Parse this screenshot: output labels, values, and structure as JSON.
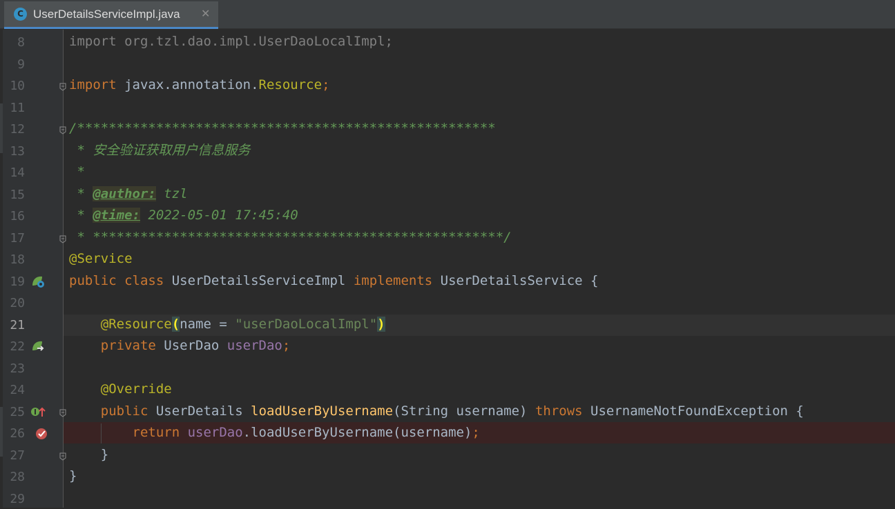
{
  "tab": {
    "title": "UserDetailsServiceImpl.java",
    "icon": "java-class-icon",
    "icon_letter": "C",
    "close": "✕"
  },
  "editor": {
    "lines": [
      {
        "n": "8",
        "segments": [
          {
            "t": "import org.tzl.dao.impl.UserDaoLocalImpl;",
            "c": "dim"
          }
        ]
      },
      {
        "n": "9",
        "segments": []
      },
      {
        "n": "10",
        "segments": [
          {
            "t": "import ",
            "c": "kw"
          },
          {
            "t": "javax.annotation.",
            "c": "cls"
          },
          {
            "t": "Resource",
            "c": "ann"
          },
          {
            "t": ";",
            "c": "kw"
          }
        ]
      },
      {
        "n": "11",
        "segments": []
      },
      {
        "n": "12",
        "segments": [
          {
            "t": "/*****************************************************",
            "c": "doc"
          }
        ]
      },
      {
        "n": "13",
        "segments": [
          {
            "t": " * 安全验证获取用户信息服务",
            "c": "doc"
          }
        ]
      },
      {
        "n": "14",
        "segments": [
          {
            "t": " *",
            "c": "doc"
          }
        ]
      },
      {
        "n": "15",
        "segments": [
          {
            "t": " * ",
            "c": "doc"
          },
          {
            "t": "@author:",
            "c": "doctag"
          },
          {
            "t": " tzl",
            "c": "doc"
          }
        ]
      },
      {
        "n": "16",
        "segments": [
          {
            "t": " * ",
            "c": "doc"
          },
          {
            "t": "@time:",
            "c": "doctag"
          },
          {
            "t": " 2022-05-01 17:45:40",
            "c": "doc"
          }
        ]
      },
      {
        "n": "17",
        "segments": [
          {
            "t": " * ****************************************************/",
            "c": "doc"
          }
        ]
      },
      {
        "n": "18",
        "segments": [
          {
            "t": "@Service",
            "c": "ann"
          }
        ]
      },
      {
        "n": "19",
        "segments": [
          {
            "t": "public class ",
            "c": "kw"
          },
          {
            "t": "UserDetailsServiceImpl ",
            "c": "cls"
          },
          {
            "t": "implements ",
            "c": "kw"
          },
          {
            "t": "UserDetailsService {",
            "c": "cls"
          }
        ]
      },
      {
        "n": "20",
        "segments": []
      },
      {
        "n": "21",
        "segments": [
          {
            "t": "    ",
            "c": "cls"
          },
          {
            "t": "@Resource",
            "c": "ann"
          },
          {
            "t": "(",
            "c": "paren-hl"
          },
          {
            "t": "name = ",
            "c": "cls"
          },
          {
            "t": "\"userDaoLocalImpl\"",
            "c": "str"
          },
          {
            "t": ")",
            "c": "paren-hl"
          }
        ]
      },
      {
        "n": "22",
        "segments": [
          {
            "t": "    ",
            "c": "cls"
          },
          {
            "t": "private ",
            "c": "kw"
          },
          {
            "t": "UserDao ",
            "c": "cls"
          },
          {
            "t": "userDao",
            "c": "field"
          },
          {
            "t": ";",
            "c": "kw"
          }
        ]
      },
      {
        "n": "23",
        "segments": []
      },
      {
        "n": "24",
        "segments": [
          {
            "t": "    ",
            "c": "cls"
          },
          {
            "t": "@Override",
            "c": "ann"
          }
        ]
      },
      {
        "n": "25",
        "segments": [
          {
            "t": "    ",
            "c": "cls"
          },
          {
            "t": "public ",
            "c": "kw"
          },
          {
            "t": "UserDetails ",
            "c": "cls"
          },
          {
            "t": "loadUserByUsername",
            "c": "fn"
          },
          {
            "t": "(String username) ",
            "c": "cls"
          },
          {
            "t": "throws ",
            "c": "kw"
          },
          {
            "t": "UsernameNotFoundException {",
            "c": "cls"
          }
        ]
      },
      {
        "n": "26",
        "segments": [
          {
            "t": "        ",
            "c": "cls"
          },
          {
            "t": "return ",
            "c": "kw"
          },
          {
            "t": "userDao",
            "c": "field"
          },
          {
            "t": ".loadUserByUsername(username)",
            "c": "cls"
          },
          {
            "t": ";",
            "c": "kw"
          }
        ]
      },
      {
        "n": "27",
        "segments": [
          {
            "t": "    }",
            "c": "cls"
          }
        ]
      },
      {
        "n": "28",
        "segments": [
          {
            "t": "}",
            "c": "cls"
          }
        ]
      },
      {
        "n": "29",
        "segments": []
      }
    ],
    "active_line": "21",
    "breakpoint_line": "26",
    "gutter_icons": [
      {
        "line": "19",
        "icon": "spring-bean-icon"
      },
      {
        "line": "22",
        "icon": "spring-autowired-icon"
      },
      {
        "line": "25",
        "icon": "implements-method-icon"
      },
      {
        "line": "26",
        "icon": "breakpoint-icon"
      }
    ],
    "fold_markers": [
      "10",
      "12",
      "17",
      "25",
      "27"
    ],
    "colors": {
      "keyword": "#cc7832",
      "annotation": "#bbb529",
      "string": "#6a8759",
      "field": "#9876aa",
      "method": "#ffc66d",
      "doc": "#629755",
      "breakpoint_row": "#3a2323",
      "background": "#2b2b2b"
    }
  }
}
